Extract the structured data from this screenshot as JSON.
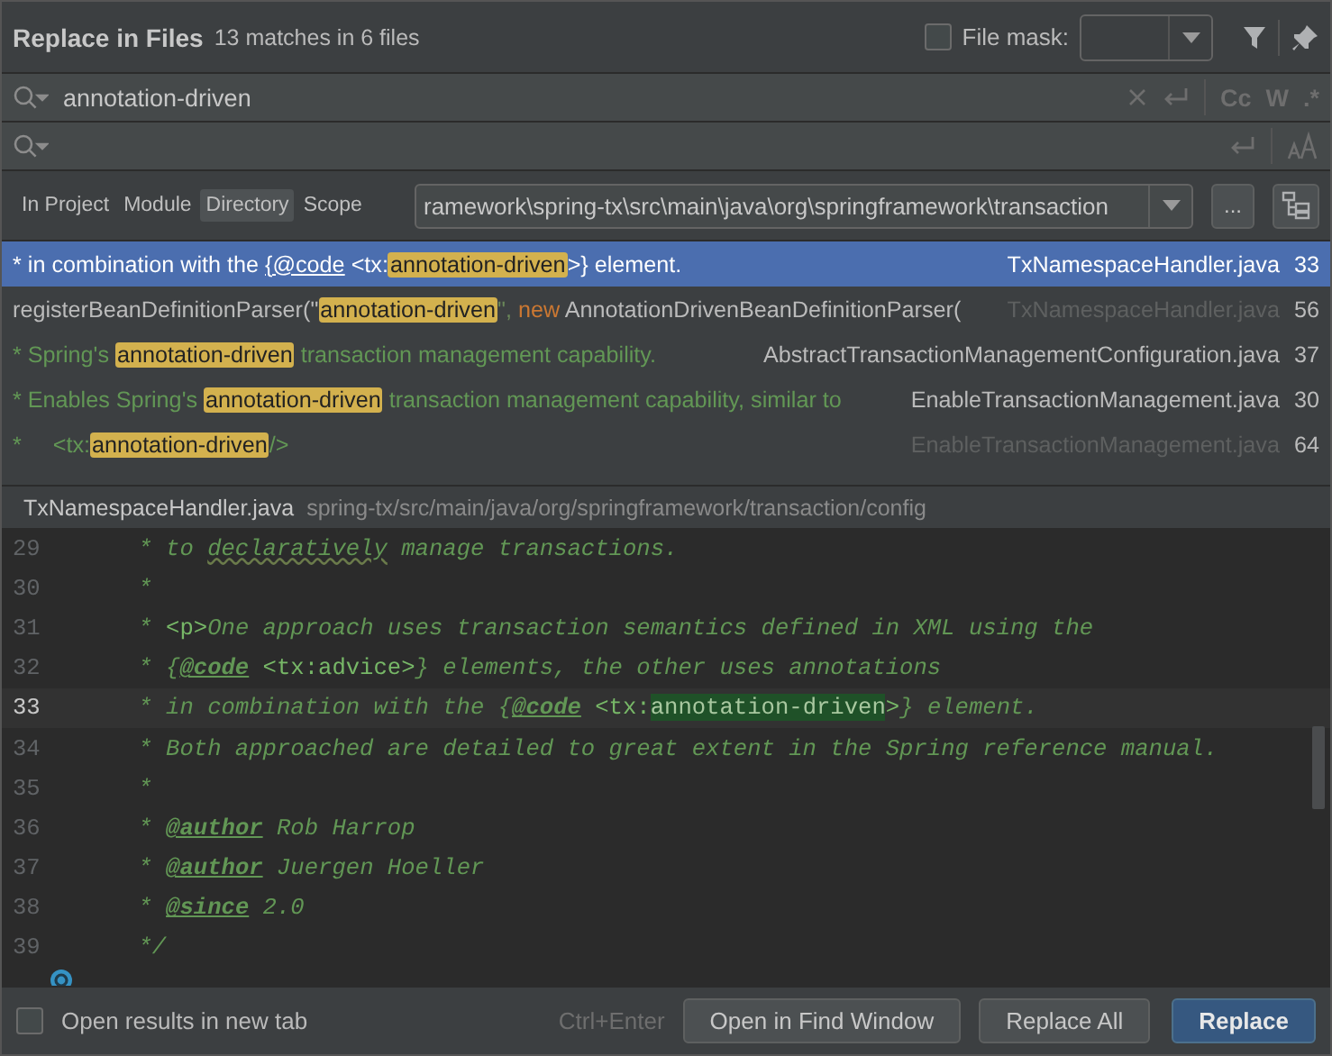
{
  "header": {
    "title": "Replace in Files",
    "summary": "13 matches in 6 files",
    "file_mask": {
      "label": "File mask:",
      "checked": false
    }
  },
  "search": {
    "value": "annotation-driven",
    "options": [
      {
        "label": "Cc",
        "selected": false
      },
      {
        "label": "W",
        "selected": false
      },
      {
        "label": ".*",
        "selected": false
      }
    ]
  },
  "scopes": [
    {
      "label": "In Project",
      "selected": false
    },
    {
      "label": "Module",
      "selected": false
    },
    {
      "label": "Directory",
      "selected": true
    },
    {
      "label": "Scope",
      "selected": false
    }
  ],
  "directory": {
    "value": "ramework\\spring-tx\\src\\main\\java\\org\\springframework\\transaction",
    "browse": "..."
  },
  "results": [
    {
      "selected": true,
      "file": "TxNamespaceHandler.java",
      "line": "33",
      "file_dim": false,
      "parts": [
        {
          "kind": "comment",
          "text": "* in combination with the "
        },
        {
          "kind": "link",
          "text": "{@code"
        },
        {
          "kind": "comment",
          "text": " <tx:"
        },
        {
          "kind": "match",
          "text": "annotation-driven"
        },
        {
          "kind": "comment",
          "text": ">} element."
        }
      ]
    },
    {
      "selected": false,
      "file": "TxNamespaceHandler.java",
      "line": "56",
      "file_dim": true,
      "parts": [
        {
          "kind": "plain",
          "text": "registerBeanDefinitionParser(\""
        },
        {
          "kind": "match",
          "text": "annotation-driven"
        },
        {
          "kind": "string",
          "text": "\", "
        },
        {
          "kind": "keyword",
          "text": "new"
        },
        {
          "kind": "plain",
          "text": " AnnotationDrivenBeanDefinitionParser("
        }
      ]
    },
    {
      "selected": false,
      "file": "AbstractTransactionManagementConfiguration.java",
      "line": "37",
      "file_dim": false,
      "parts": [
        {
          "kind": "comment",
          "text": "* Spring's "
        },
        {
          "kind": "match",
          "text": "annotation-driven"
        },
        {
          "kind": "comment",
          "text": " transaction management capability."
        }
      ]
    },
    {
      "selected": false,
      "file": "EnableTransactionManagement.java",
      "line": "30",
      "file_dim": false,
      "parts": [
        {
          "kind": "comment",
          "text": "* Enables Spring's "
        },
        {
          "kind": "match",
          "text": "annotation-driven"
        },
        {
          "kind": "comment",
          "text": " transaction management capability, similar to"
        }
      ]
    },
    {
      "selected": false,
      "file": "EnableTransactionManagement.java",
      "line": "64",
      "file_dim": true,
      "parts": [
        {
          "kind": "comment",
          "text": "*     <tx:"
        },
        {
          "kind": "match",
          "text": "annotation-driven"
        },
        {
          "kind": "comment",
          "text": "/>"
        }
      ]
    }
  ],
  "preview": {
    "file": "TxNamespaceHandler.java",
    "path": "spring-tx/src/main/java/org/springframework/transaction/config",
    "lines": [
      {
        "number": "29",
        "current": false,
        "parts": [
          {
            "kind": "comment",
            "text": " * to "
          },
          {
            "kind": "typo",
            "text": "declaratively"
          },
          {
            "kind": "comment",
            "text": " manage transactions."
          }
        ]
      },
      {
        "number": "30",
        "current": false,
        "parts": [
          {
            "kind": "comment",
            "text": " *"
          }
        ]
      },
      {
        "number": "31",
        "current": false,
        "parts": [
          {
            "kind": "comment",
            "text": " * "
          },
          {
            "kind": "tag",
            "text": "<p>"
          },
          {
            "kind": "comment",
            "text": "One approach uses transaction semantics defined in XML using the"
          }
        ]
      },
      {
        "number": "32",
        "current": false,
        "parts": [
          {
            "kind": "comment",
            "text": " * {"
          },
          {
            "kind": "doctag",
            "text": "@code"
          },
          {
            "kind": "tag",
            "text": " <tx:advice>"
          },
          {
            "kind": "comment",
            "text": "} elements, the other uses annotations"
          }
        ]
      },
      {
        "number": "33",
        "current": true,
        "parts": [
          {
            "kind": "comment",
            "text": " * in combination with the {"
          },
          {
            "kind": "doctag",
            "text": "@code"
          },
          {
            "kind": "tag",
            "text": " <tx:"
          },
          {
            "kind": "match",
            "text": "annotation-driven"
          },
          {
            "kind": "tag",
            "text": ">"
          },
          {
            "kind": "comment",
            "text": "} element."
          }
        ]
      },
      {
        "number": "34",
        "current": false,
        "parts": [
          {
            "kind": "comment",
            "text": " * Both approached are detailed to great extent in the Spring reference manual."
          }
        ]
      },
      {
        "number": "35",
        "current": false,
        "parts": [
          {
            "kind": "comment",
            "text": " *"
          }
        ]
      },
      {
        "number": "36",
        "current": false,
        "parts": [
          {
            "kind": "comment",
            "text": " * "
          },
          {
            "kind": "doctag",
            "text": "@author"
          },
          {
            "kind": "comment",
            "text": " Rob Harrop"
          }
        ]
      },
      {
        "number": "37",
        "current": false,
        "parts": [
          {
            "kind": "comment",
            "text": " * "
          },
          {
            "kind": "doctag",
            "text": "@author"
          },
          {
            "kind": "comment",
            "text": " Juergen Hoeller"
          }
        ]
      },
      {
        "number": "38",
        "current": false,
        "parts": [
          {
            "kind": "comment",
            "text": " * "
          },
          {
            "kind": "doctag",
            "text": "@since"
          },
          {
            "kind": "comment",
            "text": " 2.0"
          }
        ]
      },
      {
        "number": "39",
        "current": false,
        "parts": [
          {
            "kind": "comment",
            "text": " */"
          }
        ]
      }
    ]
  },
  "footer": {
    "new_tab": {
      "label": "Open results in new tab",
      "checked": false
    },
    "shortcut": "Ctrl+Enter",
    "buttons": [
      {
        "label": "Open in Find Window",
        "kind": "default"
      },
      {
        "label": "Replace All",
        "kind": "default"
      },
      {
        "label": "Replace",
        "kind": "primary"
      }
    ]
  }
}
